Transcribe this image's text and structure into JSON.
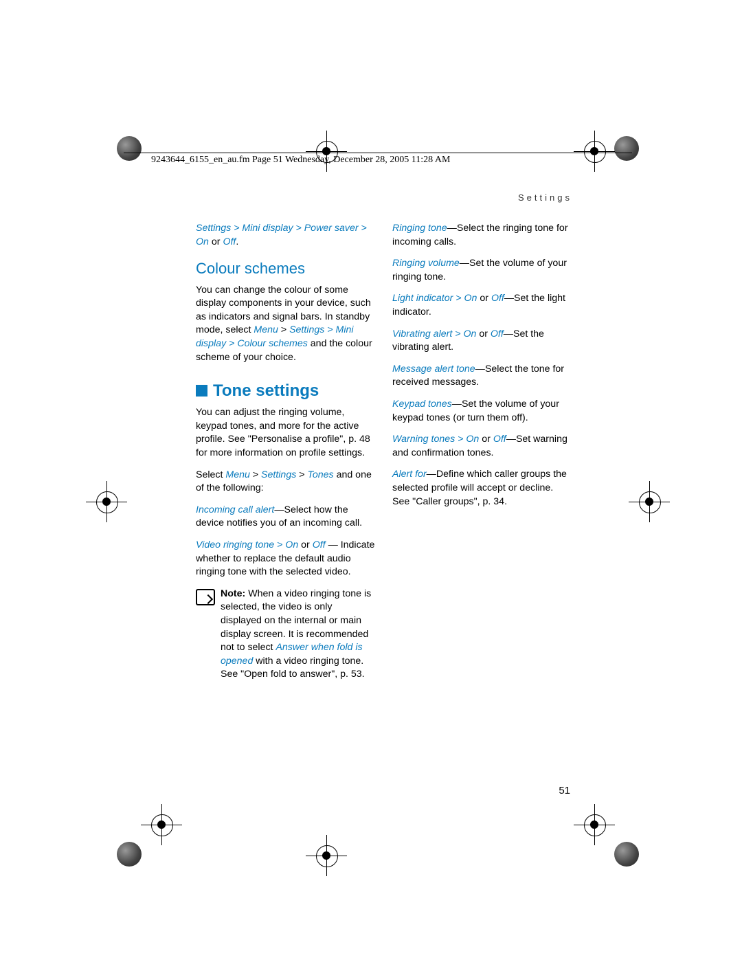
{
  "header": "9243644_6155_en_au.fm  Page 51  Wednesday, December 28, 2005  11:28 AM",
  "running_head": "Settings",
  "page_number": "51",
  "left": {
    "p1_link": "Settings > Mini display > Power saver > On",
    "p1_mid": " or ",
    "p1_link2": "Off",
    "p1_end": ".",
    "h_colour": "Colour schemes",
    "p2a": "You can change the colour of some display components in your device, such as indicators and signal bars. In standby mode, select ",
    "p2_menu": "Menu",
    "p2b": " > ",
    "p2_link": "Settings > Mini display > Colour schemes",
    "p2c": " and the colour scheme of your choice.",
    "h_tone": "Tone settings",
    "p3": "You can adjust the ringing volume, keypad tones, and more for the active profile. See \"Personalise a profile\", p. 48 for more information on profile settings.",
    "p4a": "Select ",
    "p4_menu": "Menu",
    "p4b": " > ",
    "p4_settings": "Settings",
    "p4c": " > ",
    "p4_tones": "Tones",
    "p4d": " and one of the following:",
    "p5_link": "Incoming call alert",
    "p5_rest": "—Select how the device notifies you of an incoming call.",
    "p6_link": "Video ringing tone > On",
    "p6_or": " or ",
    "p6_off": "Off",
    "p6_dash": " — Indicate whether to replace the default audio ringing tone with the selected video.",
    "note_bold": "Note: ",
    "note_a": "When a video ringing tone is selected, the video is only displayed on the internal or main display screen. It is recommended not to select ",
    "note_link": "Answer when fold is opened",
    "note_b": " with a video ringing tone. See \"Open fold to answer\", p. 53."
  },
  "right": {
    "p1_link": "Ringing tone",
    "p1_rest": "—Select the ringing tone for incoming calls.",
    "p2_link": "Ringing volume",
    "p2_rest": "—Set the volume of your ringing tone.",
    "p3_link": "Light indicator > On",
    "p3_or": " or ",
    "p3_off": "Off",
    "p3_rest": "—Set the light indicator.",
    "p4_link": "Vibrating alert  > On",
    "p4_or": " or ",
    "p4_off": "Off",
    "p4_rest": "—Set the vibrating alert.",
    "p5_link": "Message alert tone",
    "p5_rest": "—Select the tone for received messages.",
    "p6_link": "Keypad tones",
    "p6_rest": "—Set the volume of your keypad tones (or turn them off).",
    "p7_link": "Warning tones > On",
    "p7_or": " or ",
    "p7_off": "Off",
    "p7_rest": "—Set warning and confirmation tones.",
    "p8_link": "Alert for",
    "p8_rest": "—Define which caller groups the selected profile will accept or decline. See \"Caller groups\", p. 34."
  }
}
